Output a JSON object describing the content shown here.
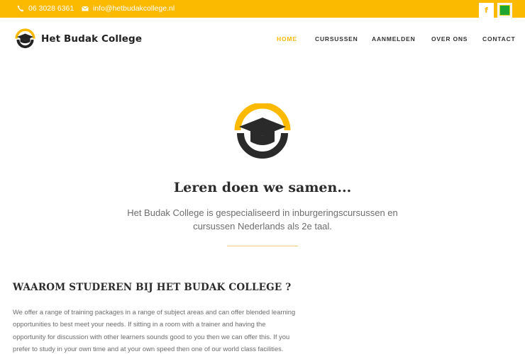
{
  "topbar": {
    "phone": "06 3028 6361",
    "email": "info@hetbudakcollege.nl",
    "facebook_icon_glyph": "f",
    "brand_color": "#fbb900"
  },
  "header": {
    "logo_text": "Het Budak College",
    "nav": [
      {
        "label": "HOME",
        "active": true
      },
      {
        "label": "CURSUSSEN",
        "active": false
      },
      {
        "label": "AANMELDEN",
        "active": false
      },
      {
        "label": "OVER ONS",
        "active": false
      },
      {
        "label": "CONTACT",
        "active": false
      }
    ]
  },
  "hero": {
    "title": "Leren doen we samen...",
    "subtitle": "Het Budak College is gespecialiseerd in inburgeringscursussen en cursussen Nederlands als 2e taal."
  },
  "section": {
    "title": "WAAROM STUDEREN BIJ HET BUDAK COLLEGE ?",
    "body": "We offer a range of training packages in a range of subject areas and can offer blended learning opportunities to best meet your needs. If sitting in a room with a trainer and having the opportunity for discussion with other learners sounds good to you then we can offer this. If you prefer to study in your own time and at your own speed then one of our world class facilities."
  }
}
